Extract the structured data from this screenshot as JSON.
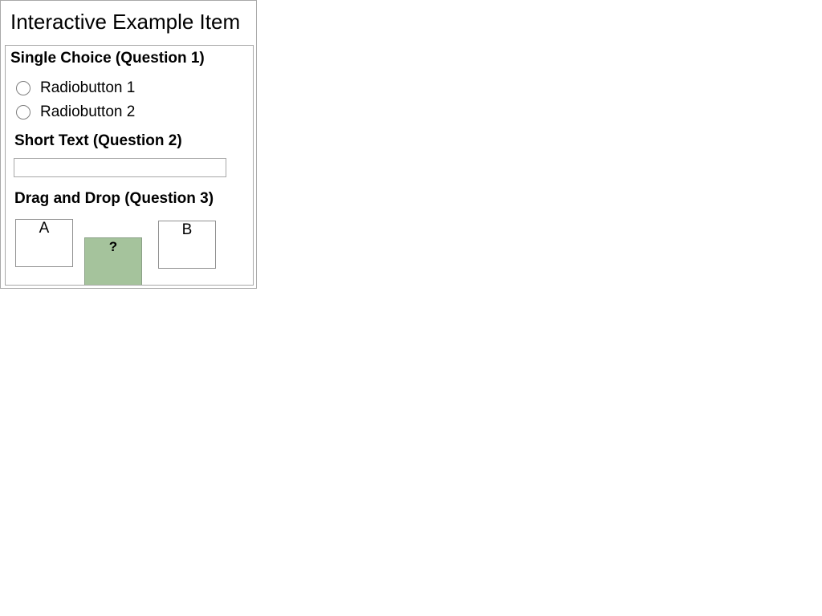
{
  "item": {
    "title": "Interactive Example Item"
  },
  "question1": {
    "heading": "Single Choice (Question 1)",
    "options": [
      {
        "label": "Radiobutton 1",
        "selected": false
      },
      {
        "label": "Radiobutton 2",
        "selected": false
      }
    ]
  },
  "question2": {
    "heading": "Short Text  (Question 2)",
    "value": "",
    "placeholder": ""
  },
  "question3": {
    "heading": "Drag and Drop (Question 3)",
    "target_a_label": "A",
    "target_b_label": "B",
    "token_label": "?",
    "token_color": "#a5c39c"
  }
}
